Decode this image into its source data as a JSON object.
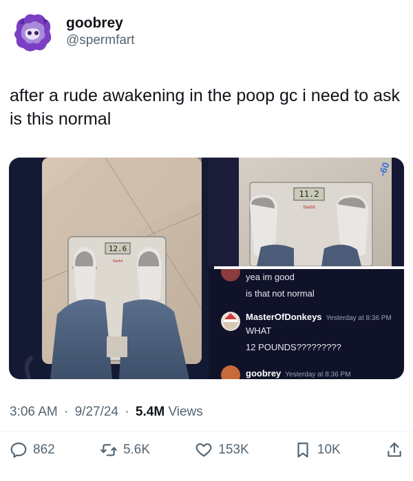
{
  "author": {
    "display_name": "goobrey",
    "handle": "@spermfart"
  },
  "tweet": {
    "text": "after a rude awakening in the poop gc i need to ask is this normal"
  },
  "media": {
    "scale_left_reading": "12.6",
    "scale_right_reading": "11.2",
    "scale_brand": "Starfrit",
    "corner_badge": "-60",
    "chat": {
      "message_1_line_1": "yea im good",
      "message_1_line_2": "is that not normal",
      "message_2_author": "MasterOfDonkeys",
      "message_2_time": "Yesterday at 8:36 PM",
      "message_2_line_1": "WHAT",
      "message_2_line_2": "12 POUNDS?????????",
      "message_3_author": "goobrey",
      "message_3_time": "Yesterday at 8:36 PM"
    }
  },
  "meta": {
    "time": "3:06 AM",
    "date": "9/27/24",
    "views_count": "5.4M",
    "views_label": "Views",
    "separator": "·"
  },
  "actions": {
    "replies": "862",
    "reposts": "5.6K",
    "likes": "153K",
    "bookmarks": "10K"
  },
  "colors": {
    "text_primary": "#0f1419",
    "text_secondary": "#536471",
    "chat_background": "#10122a"
  }
}
